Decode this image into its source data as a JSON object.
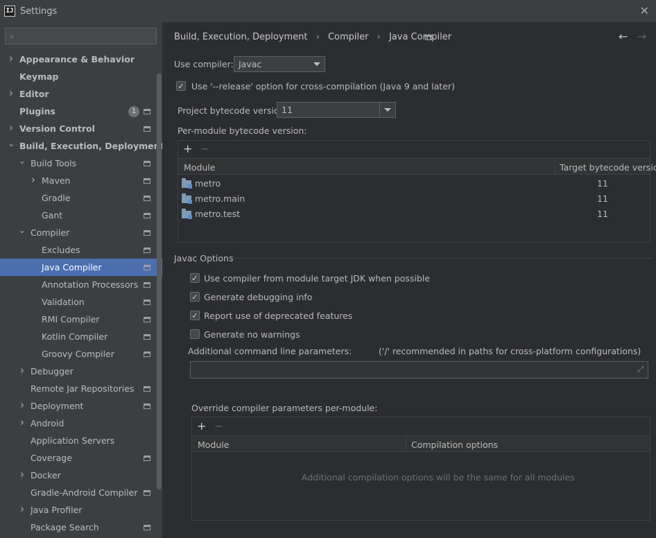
{
  "window": {
    "title": "Settings",
    "app_icon_text": "IJ"
  },
  "search": {
    "placeholder": ""
  },
  "sidebar": {
    "items": [
      {
        "label": "Appearance & Behavior",
        "bold": true,
        "arrow": "right"
      },
      {
        "label": "Keymap",
        "bold": true
      },
      {
        "label": "Editor",
        "bold": true,
        "arrow": "right"
      },
      {
        "label": "Plugins",
        "bold": true,
        "badge": "1",
        "proj": true
      },
      {
        "label": "Version Control",
        "bold": true,
        "arrow": "right",
        "proj": true
      },
      {
        "label": "Build, Execution, Deployment",
        "bold": true,
        "arrow": "down"
      },
      {
        "label": "Build Tools",
        "arrow": "down",
        "proj": true
      },
      {
        "label": "Maven",
        "arrow": "right",
        "proj": true
      },
      {
        "label": "Gradle",
        "proj": true
      },
      {
        "label": "Gant",
        "proj": true
      },
      {
        "label": "Compiler",
        "arrow": "down",
        "proj": true
      },
      {
        "label": "Excludes",
        "proj": true
      },
      {
        "label": "Java Compiler",
        "proj": true,
        "selected": true
      },
      {
        "label": "Annotation Processors",
        "proj": true
      },
      {
        "label": "Validation",
        "proj": true
      },
      {
        "label": "RMI Compiler",
        "proj": true
      },
      {
        "label": "Kotlin Compiler",
        "proj": true
      },
      {
        "label": "Groovy Compiler",
        "proj": true
      },
      {
        "label": "Debugger",
        "arrow": "right"
      },
      {
        "label": "Remote Jar Repositories",
        "proj": true
      },
      {
        "label": "Deployment",
        "arrow": "right",
        "proj": true
      },
      {
        "label": "Android",
        "arrow": "right"
      },
      {
        "label": "Application Servers"
      },
      {
        "label": "Coverage",
        "proj": true
      },
      {
        "label": "Docker",
        "arrow": "right"
      },
      {
        "label": "Gradle-Android Compiler",
        "proj": true
      },
      {
        "label": "Java Profiler",
        "arrow": "right"
      },
      {
        "label": "Package Search",
        "proj": true
      }
    ]
  },
  "breadcrumb": {
    "items": [
      "Build, Execution, Deployment",
      "Compiler",
      "Java Compiler"
    ],
    "separator": "›"
  },
  "compiler": {
    "use_compiler_label": "Use compiler:",
    "use_compiler_value": "Javac",
    "release_option_label": "Use '--release' option for cross-compilation (Java 9 and later)",
    "release_option_checked": true,
    "project_bytecode_label": "Project bytecode version:",
    "project_bytecode_value": "11",
    "per_module_label": "Per-module bytecode version:"
  },
  "module_table": {
    "headers": [
      "Module",
      "Target bytecode version"
    ],
    "rows": [
      {
        "module": "metro",
        "version": "11"
      },
      {
        "module": "metro.main",
        "version": "11"
      },
      {
        "module": "metro.test",
        "version": "11"
      }
    ]
  },
  "javac_options": {
    "section_title": "Javac Options",
    "checkboxes": [
      {
        "label": "Use compiler from module target JDK when possible",
        "checked": true
      },
      {
        "label": "Generate debugging info",
        "checked": true
      },
      {
        "label": "Report use of deprecated features",
        "checked": true
      },
      {
        "label": "Generate no warnings",
        "checked": false
      }
    ],
    "additional_params_label": "Additional command line parameters:",
    "additional_params_hint": "('/' recommended in paths for cross-platform configurations)",
    "additional_params_value": ""
  },
  "override": {
    "label": "Override compiler parameters per-module:",
    "headers": [
      "Module",
      "Compilation options"
    ],
    "empty_text": "Additional compilation options will be the same for all modules"
  },
  "icons": {
    "add": "+",
    "remove": "−",
    "back": "←",
    "forward": "→",
    "close": "✕",
    "check": "✓"
  },
  "colors": {
    "selection": "#4b6eaf",
    "background": "#2b2d30",
    "sidebar": "#3c3f41"
  }
}
